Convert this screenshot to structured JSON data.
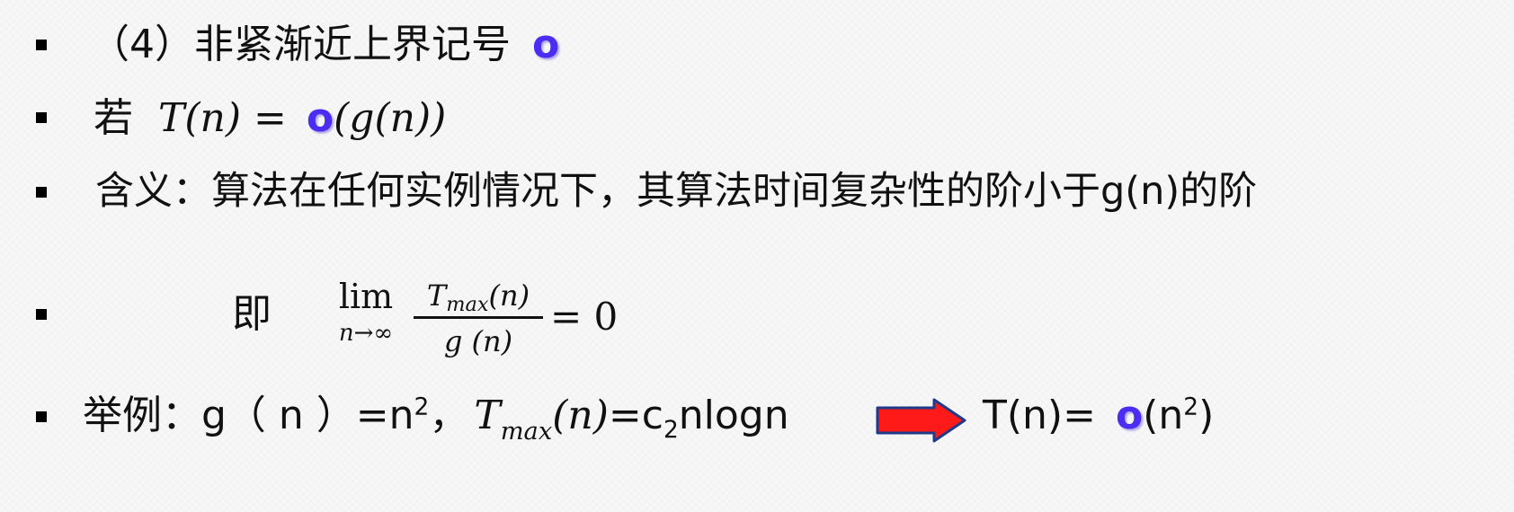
{
  "lines": {
    "l1": {
      "text": "（4）非紧渐近上界记号",
      "symbol": "o"
    },
    "l2": {
      "prefix": "若",
      "formula_left": "T(n) =",
      "symbol": "o",
      "formula_right": "(g(n))"
    },
    "l3": {
      "text": "含义：算法在任何实例情况下，其算法时间复杂性的阶小于g(n)的阶"
    },
    "l4": {
      "label": "即",
      "lim": "lim",
      "lim_sub": "n→∞",
      "numerator_T": "T",
      "numerator_sub": "max",
      "numerator_arg": "(n)",
      "denominator": "g (n)",
      "equals": "= 0"
    },
    "l5": {
      "label": "举例：",
      "g_part": "g（ n ）=n",
      "g_sup": "2",
      "comma": "，",
      "T": "T",
      "T_sub": "max",
      "T_arg": "(n)",
      "c_part": "=c",
      "c_sub": "2",
      "nlogn": "nlogn",
      "result_left": "T(n)=",
      "symbol": "o",
      "result_right_open": "(n",
      "result_sup": "2",
      "result_right_close": ")"
    }
  },
  "colors": {
    "accent_symbol": "#4a2df0",
    "arrow_fill": "#ff1a1a",
    "arrow_stroke": "#1e3a8a"
  }
}
